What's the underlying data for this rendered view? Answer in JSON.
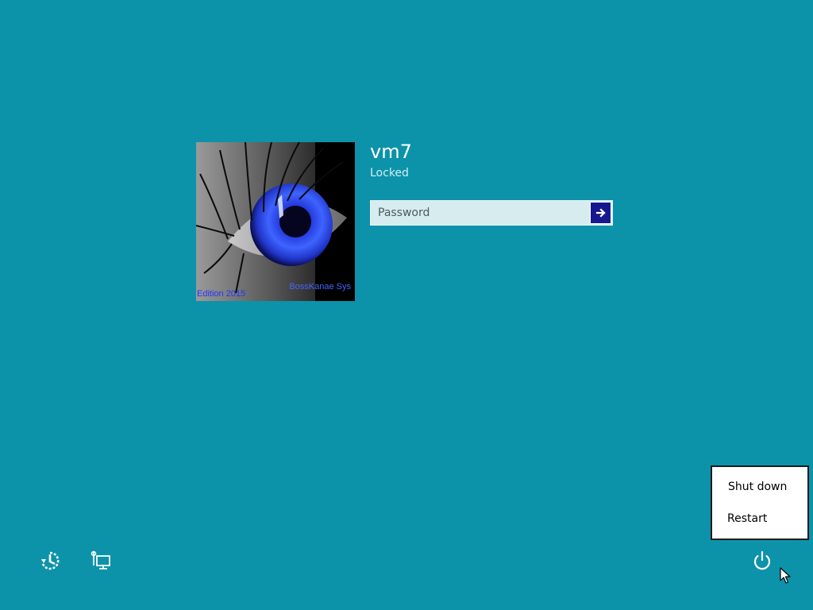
{
  "user": {
    "name": "vm7",
    "status": "Locked",
    "avatar": {
      "caption_left": "Edition 2015",
      "caption_right": "BossKanae Sys"
    }
  },
  "password": {
    "placeholder": "Password",
    "value": "",
    "submit_icon": "right-arrow-icon"
  },
  "bottom_bar": {
    "left_icons": [
      "ease-of-access-icon",
      "network-icon"
    ],
    "right_icon": "power-icon"
  },
  "power_menu": {
    "items": [
      {
        "label": "Shut down"
      },
      {
        "label": "Restart"
      }
    ]
  },
  "colors": {
    "background": "#0c93aa",
    "password_field": "#d7ecef",
    "submit_button": "#16198e",
    "menu_background": "#ffffff"
  }
}
